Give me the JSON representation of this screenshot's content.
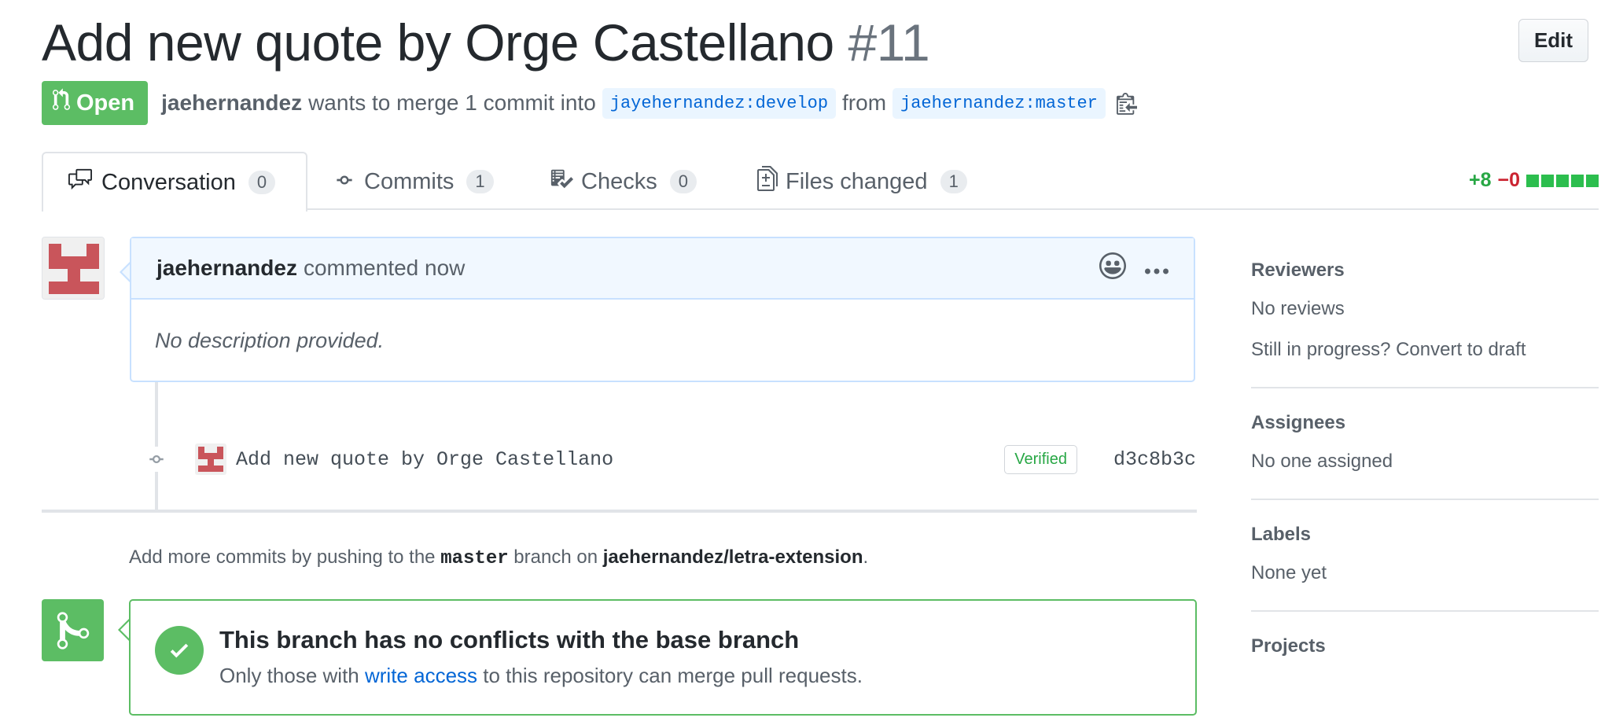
{
  "header": {
    "title": "Add new quote by Orge Castellano",
    "number": "#11",
    "edit_label": "Edit"
  },
  "meta": {
    "state": "Open",
    "author": "jaehernandez",
    "action_text": "wants to merge 1 commit into",
    "base_branch": "jayehernandez:develop",
    "from_text": "from",
    "head_branch": "jaehernandez:master"
  },
  "tabs": [
    {
      "label": "Conversation",
      "count": "0",
      "icon": "comment-discussion-icon"
    },
    {
      "label": "Commits",
      "count": "1",
      "icon": "git-commit-icon"
    },
    {
      "label": "Checks",
      "count": "0",
      "icon": "checklist-icon"
    },
    {
      "label": "Files changed",
      "count": "1",
      "icon": "file-diff-icon"
    }
  ],
  "diffstat": {
    "additions": "+8",
    "deletions": "−0",
    "color_add": "#28a745",
    "color_del": "#cb2431"
  },
  "comment": {
    "author": "jaehernandez",
    "action": "commented now",
    "body": "No description provided."
  },
  "commit": {
    "message": "Add new quote by Orge Castellano",
    "badge": "Verified",
    "sha": "d3c8b3c"
  },
  "push_note": {
    "prefix": "Add more commits by pushing to the",
    "branch": "master",
    "middle": "branch on",
    "repo": "jaehernandez/letra-extension",
    "suffix": "."
  },
  "merge": {
    "title": "This branch has no conflicts with the base branch",
    "sub_prefix": "Only those with",
    "sub_link": "write access",
    "sub_suffix": "to this repository can merge pull requests."
  },
  "sidebar": {
    "reviewers": {
      "title": "Reviewers",
      "value": "No reviews",
      "extra": "Still in progress? Convert to draft"
    },
    "assignees": {
      "title": "Assignees",
      "value": "No one assigned"
    },
    "labels": {
      "title": "Labels",
      "value": "None yet"
    },
    "projects": {
      "title": "Projects"
    }
  },
  "colors": {
    "open_green": "#5cbd64",
    "link_blue": "#0366d6",
    "identicon_red": "#c9555b"
  }
}
